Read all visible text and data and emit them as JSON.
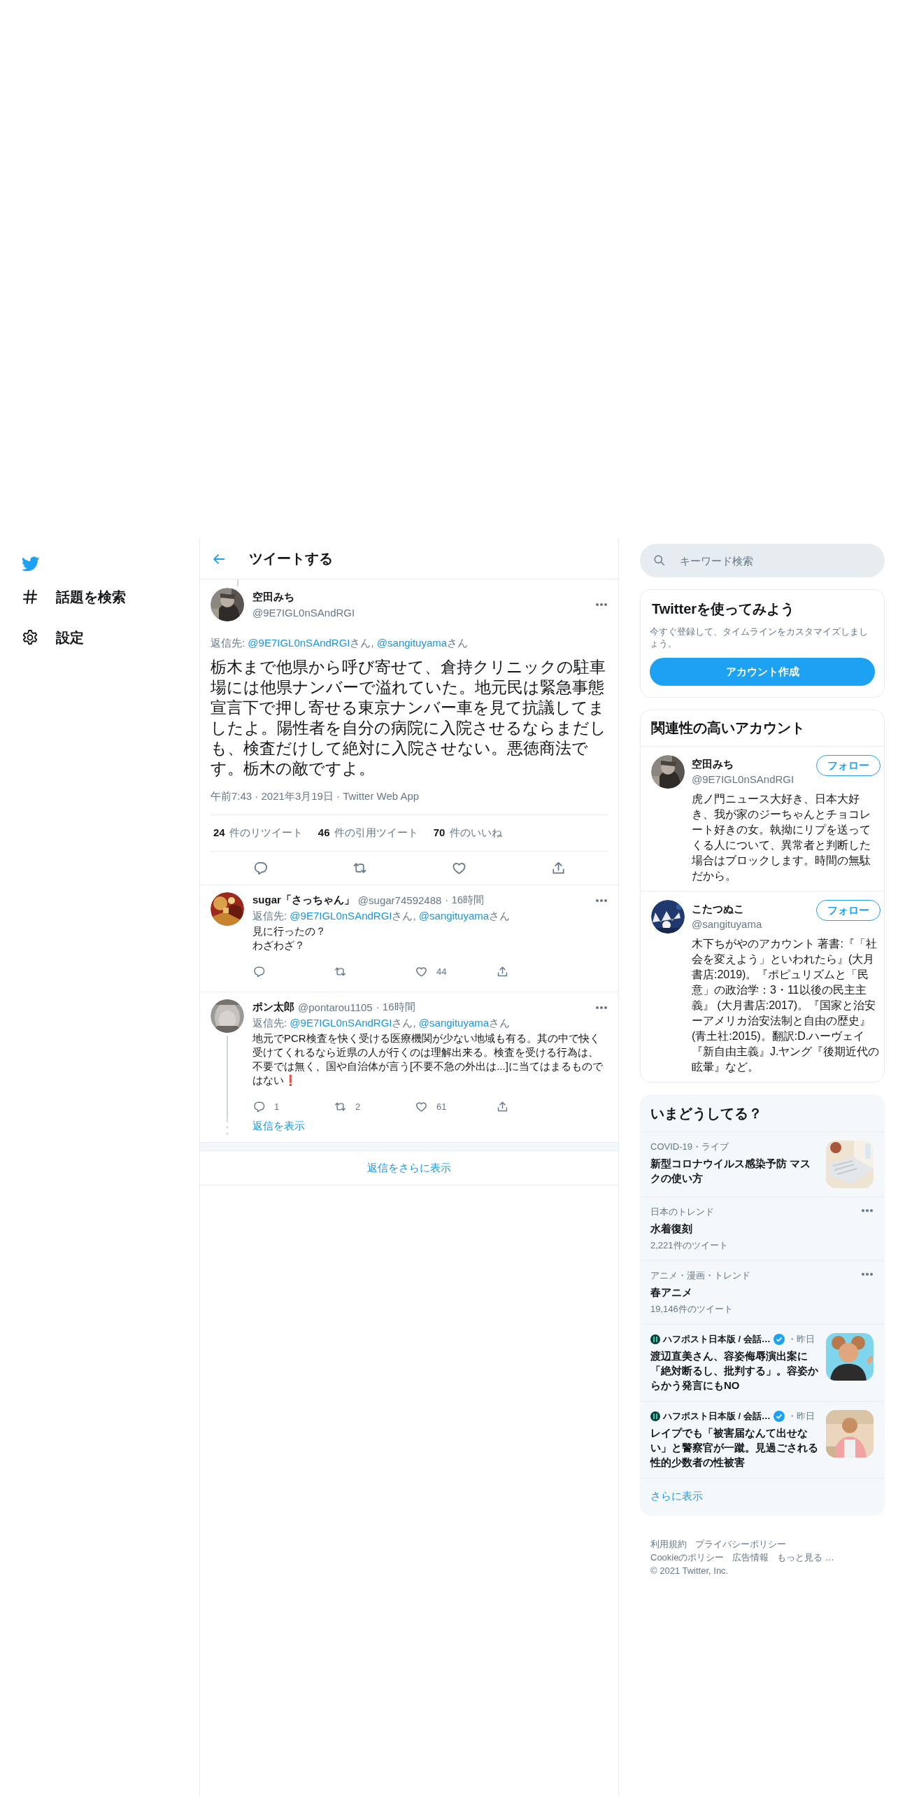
{
  "sidebar": {
    "items": [
      {
        "kind": "logo"
      },
      {
        "kind": "explore",
        "label": "話題を検索"
      },
      {
        "kind": "settings",
        "label": "設定"
      }
    ]
  },
  "header": {
    "title": "ツイートする"
  },
  "tweet": {
    "name": "空田みち",
    "handle": "@9E7IGL0nSAndRGI",
    "reply_to": {
      "label": "返信先:",
      "mentions": [
        {
          "handle": "@9E7IGL0nSAndRGI",
          "suffix": "さん,"
        },
        {
          "handle": "@sangituyama",
          "suffix": "さん"
        }
      ]
    },
    "text": "栃木まで他県から呼び寄せて、倉持クリニックの駐車場には他県ナンバーで溢れていた。地元民は緊急事態宣言下で押し寄せる東京ナンバー車を見て抗議してましたよ。陽性者を自分の病院に入院させるならまだしも、検査だけして絶対に入院させない。悪徳商法です。栃木の敵ですよ。",
    "meta": "午前7:43 · 2021年3月19日 · Twitter Web App",
    "stats": [
      {
        "count": "24",
        "label": "件のリツイート"
      },
      {
        "count": "46",
        "label": "件の引用ツイート"
      },
      {
        "count": "70",
        "label": "件のいいね"
      }
    ],
    "actions": [
      {
        "kind": "reply"
      },
      {
        "kind": "retweet"
      },
      {
        "kind": "like"
      },
      {
        "kind": "share"
      }
    ]
  },
  "replies": [
    {
      "name": "sugar「さっちゃん」",
      "handle": "@sugar74592488",
      "time": "· 16時間",
      "reply_to": {
        "label": "返信先:",
        "mentions": [
          {
            "handle": "@9E7IGL0nSAndRGI",
            "suffix": "さん,"
          },
          {
            "handle": "@sangituyama",
            "suffix": "さん"
          }
        ]
      },
      "text": [
        "見に行ったの？",
        "わざわざ？"
      ],
      "thread": false,
      "actions": [
        {
          "kind": "reply"
        },
        {
          "kind": "retweet"
        },
        {
          "kind": "like",
          "count": "44"
        },
        {
          "kind": "share"
        }
      ]
    },
    {
      "name": "ポン太郎",
      "handle": "@pontarou1105",
      "time": "· 16時間",
      "reply_to": {
        "label": "返信先:",
        "mentions": [
          {
            "handle": "@9E7IGL0nSAndRGI",
            "suffix": "さん,"
          },
          {
            "handle": "@sangituyama",
            "suffix": "さん"
          }
        ]
      },
      "text": [
        "地元でPCR検査を快く受ける医療機関が少ない地域も有る。其の中で快く受けてくれるなら近県の人が行くのは理解出来る。検査を受ける行為は、不要では無く、国や自治体が言う[不要不急の外出は...]に当てはまるものではない❗"
      ],
      "thread": true,
      "show_replies": "返信を表示",
      "actions": [
        {
          "kind": "reply",
          "count": "1"
        },
        {
          "kind": "retweet",
          "count": "2"
        },
        {
          "kind": "like",
          "count": "61"
        },
        {
          "kind": "share"
        }
      ]
    }
  ],
  "show_more": "返信をさらに表示",
  "search": {
    "placeholder": "キーワード検索"
  },
  "signup": {
    "title": "Twitterを使ってみよう",
    "text": "今すぐ登録して、タイムラインをカスタマイズしましょう。",
    "button": "アカウント作成"
  },
  "who_to_follow": {
    "title": "関連性の高いアカウント",
    "accounts": [
      {
        "name": "空田みち",
        "handle": "@9E7IGL0nSAndRGI",
        "button": "フォロー",
        "bio": "虎ノ門ニュース大好き、日本大好き、我が家のジーちゃんとチョコレート好きの女。執拗にリプを送ってくる人について、異常者と判断した場合はブロックします。時間の無駄だから。"
      },
      {
        "name": "こたつぬこ",
        "handle": "@sangituyama",
        "button": "フォロー",
        "bio": "木下ちがやのアカウント 著書:『「社会を変えよう」といわれたら』(大月書店:2019)。『ポピュリズムと「民意」の政治学：3・11以後の民主主義』 (大月書店:2017)。『国家と治安ーアメリカ治安法制と自由の歴史』(青土社:2015)。翻訳:D.ハーヴェイ『新自由主義』J.ヤング『後期近代の眩暈』など。"
      }
    ]
  },
  "trends": {
    "title": "いまどうしてる？",
    "items": [
      {
        "kind": "media",
        "context": "COVID-19・ライブ",
        "title": "新型コロナウイルス感染予防 マスクの使い方"
      },
      {
        "kind": "trend",
        "context": "日本のトレンド",
        "title": "水着復刻",
        "count": "2,221件のツイート"
      },
      {
        "kind": "trend",
        "context": "アニメ・漫画・トレンド",
        "title": "春アニメ",
        "count": "19,146件のツイート"
      },
      {
        "kind": "news",
        "source": "ハフポスト日本版 / 会話…",
        "verified": true,
        "time": "・昨日",
        "title": "渡辺直美さん、容姿侮辱演出案に「絶対断るし、批判する」。容姿からかう発言にもNO"
      },
      {
        "kind": "news",
        "source": "ハフポスト日本版 / 会話…",
        "verified": true,
        "time": "・昨日",
        "title": "レイプでも「被害届なんて出せない」と警察官が一蹴。見過ごされる性的少数者の性被害"
      }
    ],
    "more": "さらに表示"
  },
  "footer": {
    "rows": [
      [
        "利用規約",
        "プライバシーポリシー"
      ],
      [
        "Cookieのポリシー",
        "広告情報",
        "もっと見る …"
      ]
    ],
    "copyright": "© 2021 Twitter, Inc."
  }
}
